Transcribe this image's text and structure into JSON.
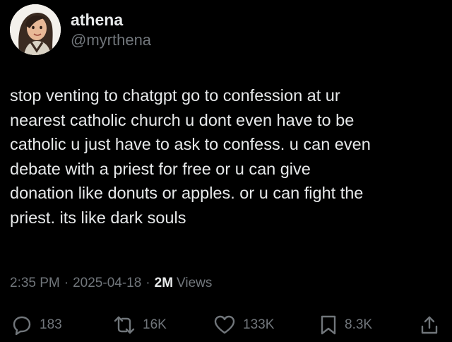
{
  "author": {
    "display_name": "athena",
    "handle": "@myrthena"
  },
  "tweet": {
    "text": "stop venting to chatgpt go to confession at ur\nnearest catholic church u dont even have to be\ncatholic u just have to ask to confess. u can even\ndebate with a priest for free or u can give\ndonation like donuts or apples. or u can fight the\npriest. its like dark souls",
    "time": "2:35 PM",
    "date": "2025-04-18",
    "views_count": "2M",
    "views_label": "Views",
    "separator": "·"
  },
  "actions": {
    "reply": {
      "icon": "reply-icon",
      "count": "183"
    },
    "repost": {
      "icon": "repost-icon",
      "count": "16K"
    },
    "like": {
      "icon": "heart-icon",
      "count": "133K"
    },
    "bookmark": {
      "icon": "bookmark-icon",
      "count": "8.3K"
    },
    "share": {
      "icon": "share-icon"
    }
  },
  "colors": {
    "background": "#000000",
    "primary_text": "#e7e9ea",
    "secondary_text": "#71767b"
  }
}
